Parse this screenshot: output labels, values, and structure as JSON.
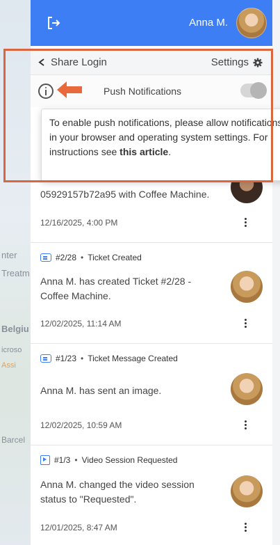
{
  "background": {
    "fragments": [
      "nter",
      "Treatm",
      "Belgiu",
      "icroso",
      "Assi",
      "Barcel"
    ]
  },
  "header": {
    "user_name": "Anna M.",
    "bg_color": "#3d7ef5"
  },
  "toolbar": {
    "share_label": "Share Login",
    "settings_label": "Settings"
  },
  "push": {
    "label": "Push Notifications",
    "enabled": false
  },
  "tooltip": {
    "text": "To enable push notifications, please allow notifications in your browser and operating system settings. For instructions see ",
    "link": "this article",
    "end": "."
  },
  "highlight_color": "#d9663f",
  "feed": [
    {
      "message": "05929157b72a95 with Coffee Machine.",
      "date": "12/16/2025, 4:00 PM"
    },
    {
      "id": "#2/28",
      "type": "Ticket Created",
      "icon": "ticket-icon",
      "message": "Anna M. has created Ticket #2/28 - Coffee Machine.",
      "date": "12/02/2025, 11:14 AM"
    },
    {
      "id": "#1/23",
      "type": "Ticket Message Created",
      "icon": "ticket-icon",
      "message": "Anna M. has sent an image.",
      "date": "12/02/2025, 10:59 AM"
    },
    {
      "id": "#1/3",
      "type": "Video Session Requested",
      "icon": "video-icon",
      "message": "Anna M. changed the video session status to \"Requested\".",
      "date": "12/01/2025, 8:47 AM"
    }
  ]
}
